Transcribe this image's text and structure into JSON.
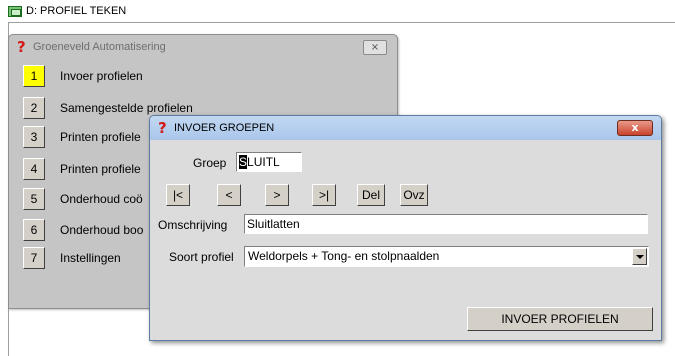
{
  "app": {
    "title": "D: PROFIEL TEKEN",
    "icon": "window-app-icon"
  },
  "menu_window": {
    "title": "Groeneveld Automatisering",
    "icon": "question-icon",
    "close_label": "⨯",
    "items": [
      {
        "num": "1",
        "label": "Invoer profielen",
        "active": true
      },
      {
        "num": "2",
        "label": "Samengestelde profielen",
        "active": false
      },
      {
        "num": "3",
        "label": "Printen profiele",
        "active": false
      },
      {
        "num": "4",
        "label": "Printen profiele",
        "active": false
      },
      {
        "num": "5",
        "label": "Onderhoud coö",
        "active": false
      },
      {
        "num": "6",
        "label": "Onderhoud boo",
        "active": false
      },
      {
        "num": "7",
        "label": "Instellingen",
        "active": false
      }
    ]
  },
  "dialog": {
    "title": "INVOER GROEPEN",
    "icon": "question-icon",
    "close_label": "x",
    "groep_label": "Groep",
    "groep_caret_char": "S",
    "groep_rest": "LUITL",
    "nav_buttons": [
      "|<",
      "<",
      ">",
      ">|",
      "Del",
      "Ovz"
    ],
    "omschrijving_label": "Omschrijving",
    "omschrijving_value": "Sluitlatten",
    "soort_label": "Soort profiel",
    "soort_value": "Weldorpels + Tong- en stolpnaalden",
    "invoer_button": "INVOER PROFIELEN"
  },
  "colors": {
    "active_number": "#ffff00",
    "question_mark": "#d21a1a",
    "dialog_title_bar": "#b8d0ee",
    "close_button": "#c8432c"
  }
}
